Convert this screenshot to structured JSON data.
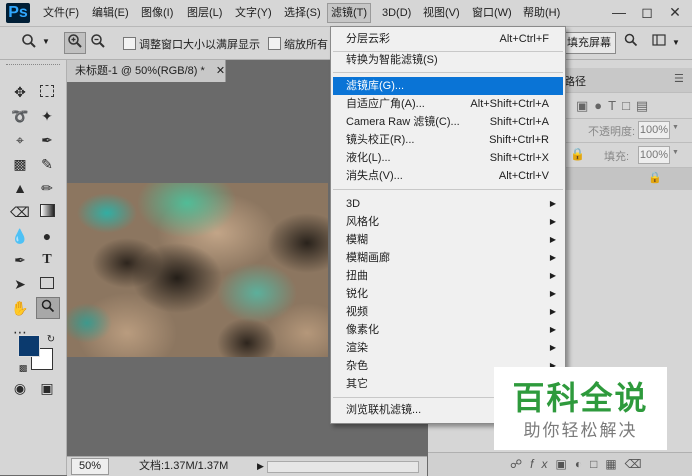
{
  "app": {
    "logo": "Ps"
  },
  "menubar": {
    "items": [
      "文件(F)",
      "编辑(E)",
      "图像(I)",
      "图层(L)",
      "文字(Y)",
      "选择(S)",
      "滤镜(T)",
      "3D(D)",
      "视图(V)",
      "窗口(W)",
      "帮助(H)"
    ],
    "active_index": 6,
    "window_controls": [
      "minimize-icon",
      "maximize-icon",
      "close-icon"
    ]
  },
  "optionsbar": {
    "tool_icon": "zoom-icon",
    "zoom_in_icon": "zoom-in-icon",
    "zoom_out_icon": "zoom-out-icon",
    "resize_windows_label": "调整窗口大小以满屏显示",
    "zoom_all_label": "缩放所有",
    "fill_screen_label": "填充屏幕"
  },
  "document": {
    "tab_title": "未标题-1 @ 50%(RGB/8) *",
    "close_icon": "close-icon",
    "zoom_value": "50%",
    "doc_info": "文档:1.37M/1.37M"
  },
  "tools": {
    "foreground_color": "#0b3a6e",
    "background_color": "#ffffff"
  },
  "rightpanel": {
    "tab_fragment": "路径",
    "opacity_label": "不透明度:",
    "opacity_value": "100%",
    "fill_label": "填充:",
    "fill_value": "100%"
  },
  "filter_menu": {
    "items": [
      {
        "label": "分层云彩",
        "shortcut": "Alt+Ctrl+F"
      },
      {
        "sep": true
      },
      {
        "label": "转换为智能滤镜(S)"
      },
      {
        "sep": true
      },
      {
        "label": "滤镜库(G)...",
        "highlight": true
      },
      {
        "label": "自适应广角(A)...",
        "shortcut": "Alt+Shift+Ctrl+A"
      },
      {
        "label": "Camera Raw 滤镜(C)...",
        "shortcut": "Shift+Ctrl+A"
      },
      {
        "label": "镜头校正(R)...",
        "shortcut": "Shift+Ctrl+R"
      },
      {
        "label": "液化(L)...",
        "shortcut": "Shift+Ctrl+X"
      },
      {
        "label": "消失点(V)...",
        "shortcut": "Alt+Ctrl+V"
      },
      {
        "sep": true
      },
      {
        "label": "3D",
        "submenu": true
      },
      {
        "label": "风格化",
        "submenu": true
      },
      {
        "label": "模糊",
        "submenu": true
      },
      {
        "label": "模糊画廊",
        "submenu": true
      },
      {
        "label": "扭曲",
        "submenu": true
      },
      {
        "label": "锐化",
        "submenu": true
      },
      {
        "label": "视频",
        "submenu": true
      },
      {
        "label": "像素化",
        "submenu": true
      },
      {
        "label": "渲染",
        "submenu": true
      },
      {
        "label": "杂色",
        "submenu": true
      },
      {
        "label": "其它",
        "submenu": true
      },
      {
        "sep": true
      },
      {
        "label": "浏览联机滤镜..."
      }
    ]
  },
  "watermark": {
    "title": "百科全说",
    "subtitle": "助你轻松解决"
  }
}
